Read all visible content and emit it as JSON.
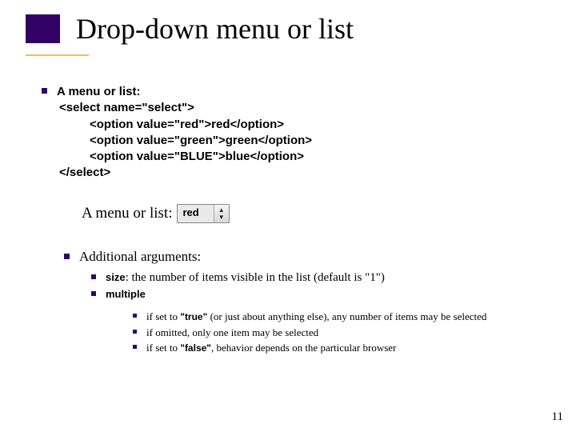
{
  "title": "Drop-down menu or list",
  "intro": "A menu or list:",
  "code": [
    "<select name=\"select\">",
    "<option value=\"red\">red</option>",
    "<option value=\"green\">green</option>",
    "<option value=\"BLUE\">blue</option>",
    "</select>"
  ],
  "example": {
    "label": "A menu or list:",
    "value": "red"
  },
  "additional": {
    "heading": "Additional arguments:",
    "args": [
      {
        "name": "size",
        "desc": ": the number of items visible in the list (default is \"1\")"
      },
      {
        "name": "multiple",
        "notes": [
          {
            "pre": "if set to ",
            "kw": "\"true\"",
            "post": " (or just about anything else), any number of items may be selected"
          },
          {
            "text": "if omitted, only one item may be selected"
          },
          {
            "pre": "if set to ",
            "kw": "\"false\"",
            "post": ", behavior depends on the particular browser"
          }
        ]
      }
    ]
  },
  "page": "11"
}
